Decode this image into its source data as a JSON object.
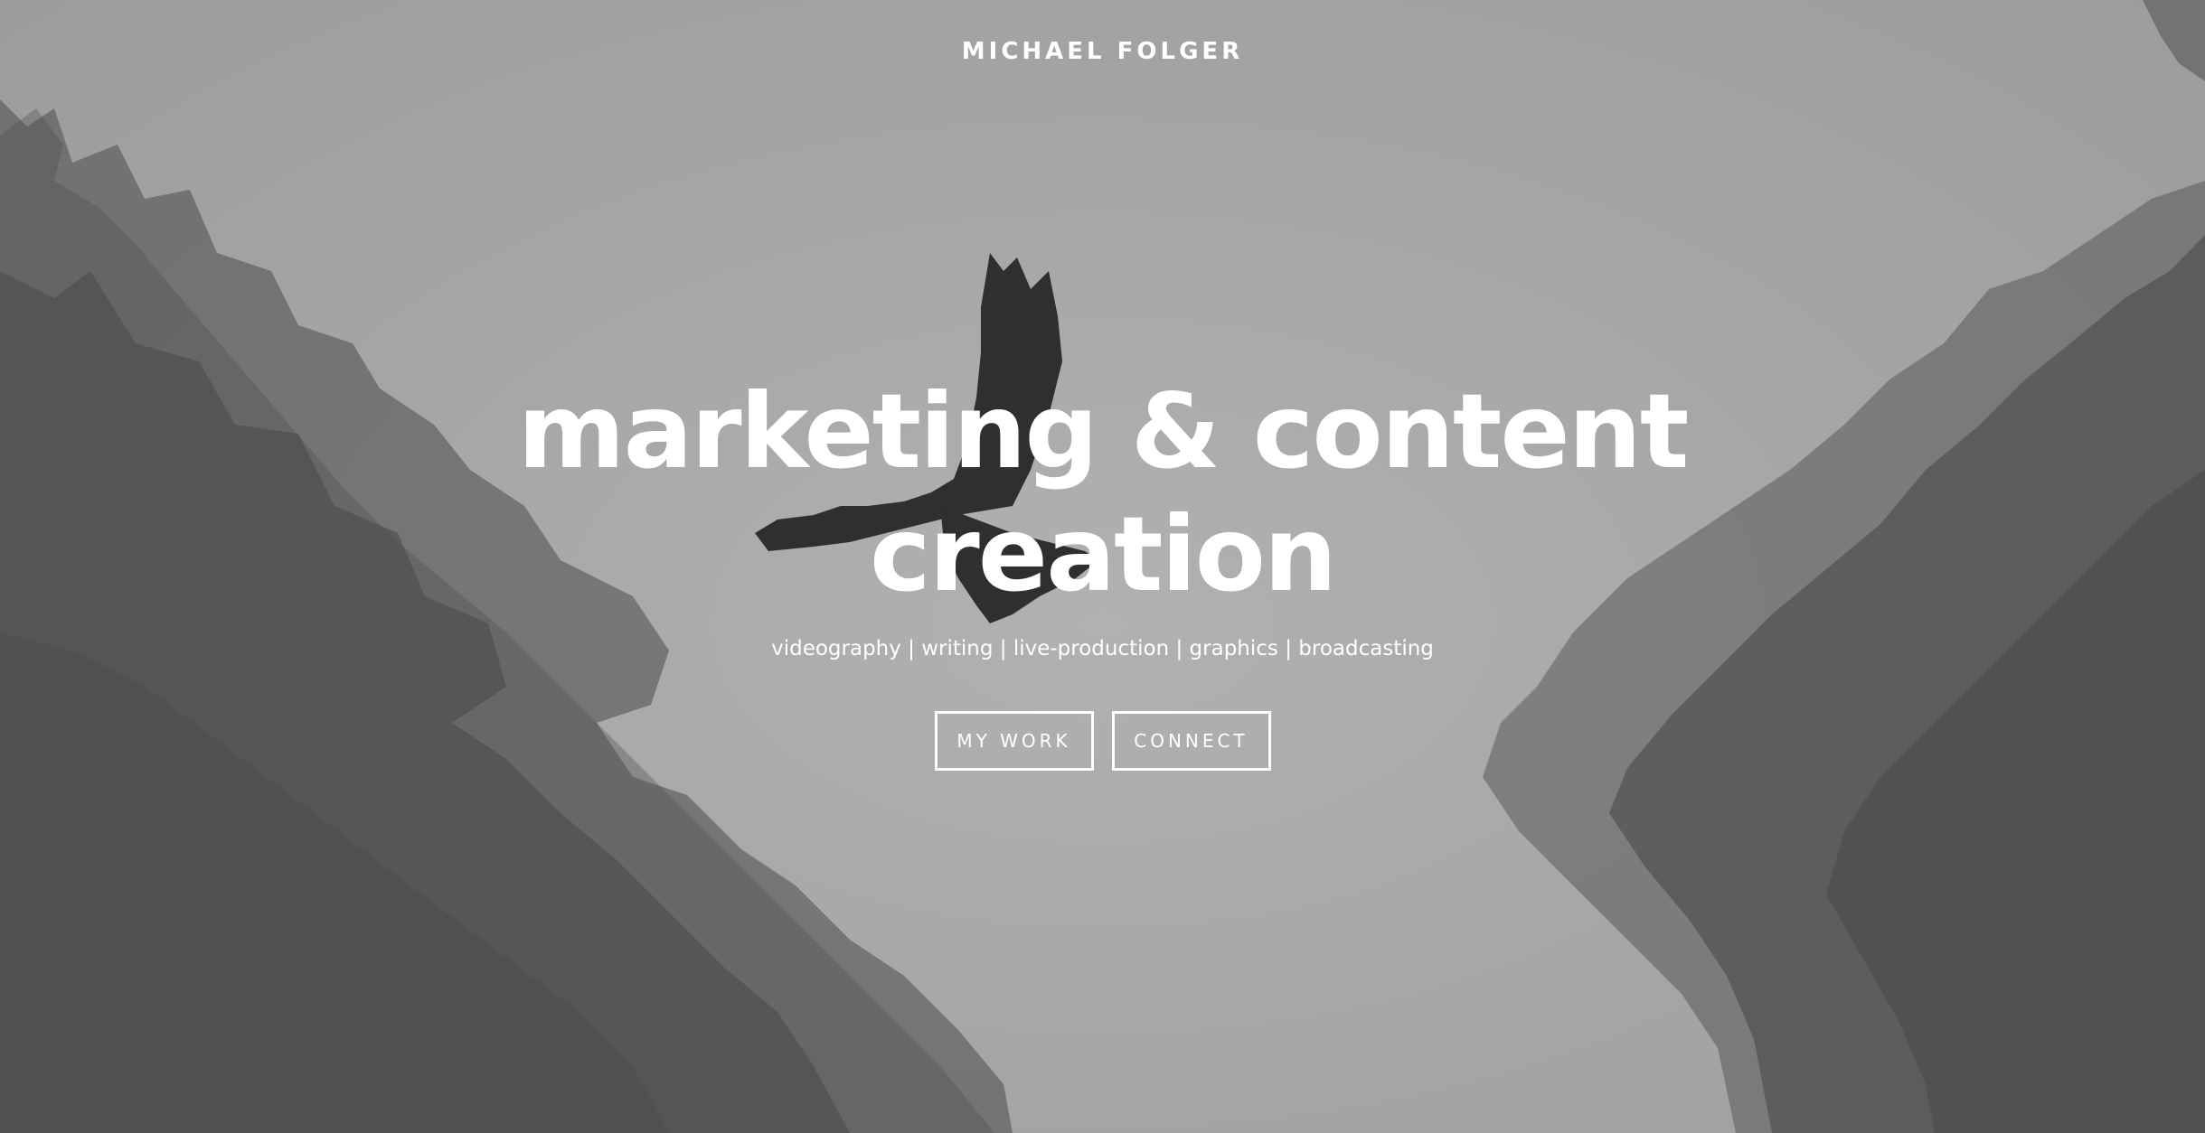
{
  "header": {
    "brand": "MICHAEL FOLGER"
  },
  "hero": {
    "headline_line1": "marketing & content",
    "headline_line2": "creation",
    "subtitle": "videography | writing | live-production | graphics | broadcasting",
    "buttons": [
      {
        "label": "MY WORK"
      },
      {
        "label": "CONNECT"
      }
    ],
    "background": {
      "subject": "bird-flying-between-pine-trees",
      "tone": "grayscale"
    }
  },
  "colors": {
    "text": "#ffffff",
    "sky": "#a6a6a6",
    "trees": "#4a4a4a"
  }
}
